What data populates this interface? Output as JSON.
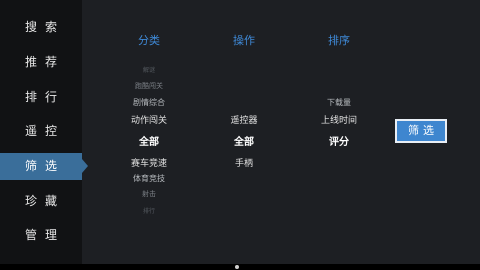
{
  "sidebar": {
    "items": [
      {
        "label": "搜索"
      },
      {
        "label": "推荐"
      },
      {
        "label": "排行"
      },
      {
        "label": "遥控"
      },
      {
        "label": "筛选"
      },
      {
        "label": "珍藏"
      },
      {
        "label": "管理"
      }
    ],
    "active": "筛选"
  },
  "filters": {
    "category": {
      "header": "分类",
      "options": [
        "解谜",
        "跑酷闯关",
        "剧情综合",
        "动作闯关",
        "全部",
        "赛车竞速",
        "体育竞技",
        "射击",
        "排行"
      ],
      "selected": "全部"
    },
    "operation": {
      "header": "操作",
      "options": [
        "遥控器",
        "全部",
        "手柄"
      ],
      "selected": "全部"
    },
    "sort": {
      "header": "排序",
      "options": [
        "下载量",
        "上线时间",
        "评分"
      ],
      "selected": "评分"
    }
  },
  "filter_button": {
    "label": "筛选"
  },
  "colors": {
    "accent": "#3e86cf",
    "header": "#3f8ad8",
    "sidebar_active": "#3a6e9a"
  }
}
